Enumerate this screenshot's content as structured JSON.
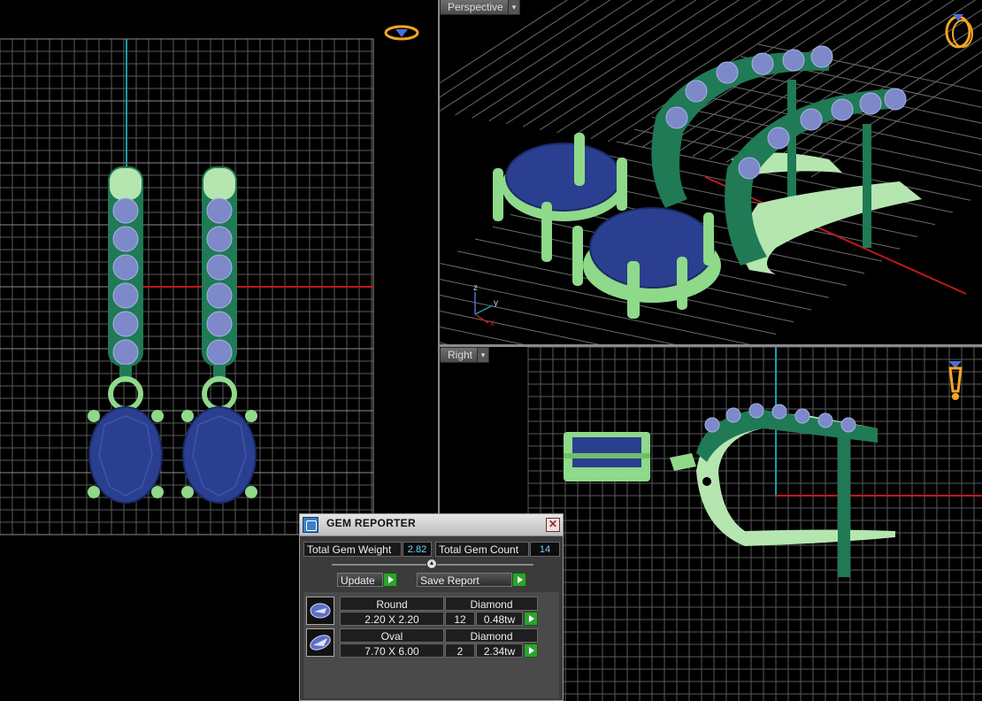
{
  "viewports": {
    "perspective": {
      "label": "Perspective"
    },
    "right": {
      "label": "Right"
    }
  },
  "axis_labels": {
    "z": "z",
    "y": "y",
    "x": "x"
  },
  "gem_reporter": {
    "title": "GEM REPORTER",
    "total_weight_label": "Total Gem Weight",
    "total_weight_value": "2.82",
    "total_count_label": "Total Gem Count",
    "total_count_value": "14",
    "update_label": "Update",
    "save_report_label": "Save Report",
    "gems": [
      {
        "shape": "Round",
        "type": "Diamond",
        "size": "2.20 X 2.20",
        "count": "12",
        "weight": "0.48tw"
      },
      {
        "shape": "Oval",
        "type": "Diamond",
        "size": "7.70 X 6.00",
        "count": "2",
        "weight": "2.34tw"
      }
    ]
  },
  "colors": {
    "metal_dark": "#1f7a55",
    "metal_light": "#8fd98a",
    "metal_pale": "#b5e6b0",
    "gem_blue": "#2a3f8f",
    "small_gem": "#7d89c8",
    "grid": "#5a5a5a",
    "axis_red": "#c0181c",
    "axis_cyan": "#1a9fa8",
    "icon_orange": "#f5a623"
  }
}
